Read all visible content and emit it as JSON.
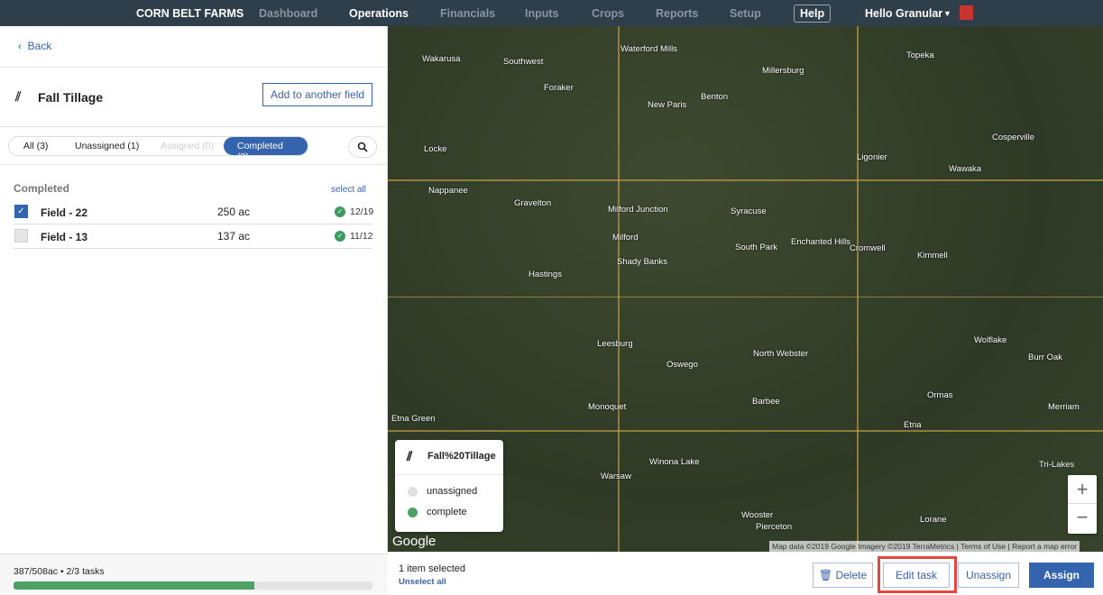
{
  "nav": {
    "brand": "CORN BELT FARMS",
    "items": [
      "Dashboard",
      "Operations",
      "Financials",
      "Inputs",
      "Crops",
      "Reports",
      "Setup"
    ],
    "active": "Operations",
    "help": "Help",
    "user": "Hello Granular"
  },
  "sidebar": {
    "back": "Back",
    "task_title": "Fall Tillage",
    "add_button": "Add to another field",
    "tabs": [
      "All (3)",
      "Unassigned (1)",
      "Assigned (0)",
      "Completed (2)"
    ],
    "selected_tab": "Completed (2)",
    "section": "Completed",
    "select_all": "select all",
    "fields": [
      {
        "name": "Field - 22",
        "acres": "250 ac",
        "date": "12/19",
        "checked": true
      },
      {
        "name": "Field - 13",
        "acres": "137 ac",
        "date": "11/12",
        "checked": false
      }
    ],
    "progress_text": "387/508ac • 2/3 tasks",
    "progress": 0.67
  },
  "map": {
    "places": [
      "Wakarusa",
      "Southwest",
      "Waterford Mills",
      "Millersburg",
      "Topeka",
      "Foraker",
      "Benton",
      "New Paris",
      "Cosperville",
      "Locke",
      "Ligonier",
      "Wawaka",
      "Nappanee",
      "Gravelton",
      "Milford Junction",
      "Syracuse",
      "Milford",
      "South Park",
      "Enchanted Hills",
      "Cromwell",
      "Kimmell",
      "Hastings",
      "Shady Banks",
      "Leesburg",
      "Oswego",
      "North Webster",
      "Wolflake",
      "Burr Oak",
      "Monoquet",
      "Barbee",
      "Ormas",
      "Merriam",
      "Etna Green",
      "Etna",
      "Warsaw",
      "Winona Lake",
      "Tri-Lakes",
      "Wooster",
      "Pierceton",
      "Lorane"
    ],
    "legend": {
      "title": "Fall%20Tillage",
      "items": [
        {
          "label": "unassigned",
          "color": "#e0e0e0"
        },
        {
          "label": "complete",
          "color": "#4ea064"
        }
      ]
    },
    "google": "Google",
    "attribution": "Map data ©2019 Google Imagery ©2019 TerraMetrics",
    "terms": "Terms of Use",
    "report": "Report a map error"
  },
  "actions": {
    "selected": "1 item selected",
    "unselect": "Unselect all",
    "delete": "Delete",
    "edit": "Edit task",
    "unassign": "Unassign",
    "assign": "Assign"
  }
}
